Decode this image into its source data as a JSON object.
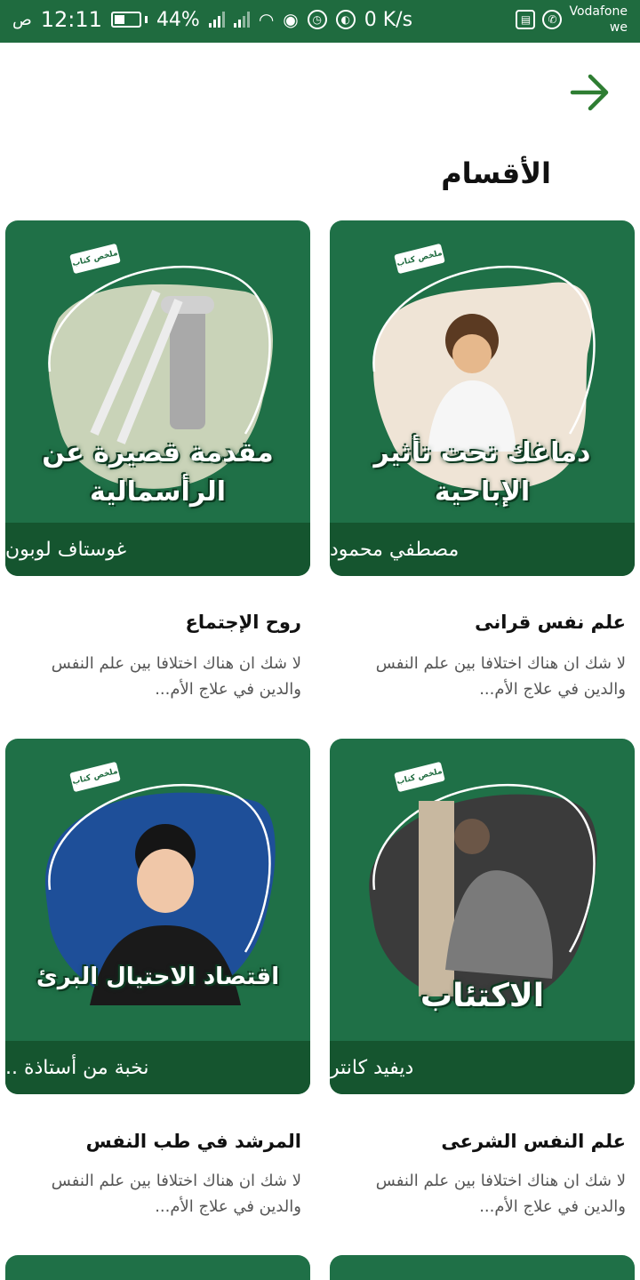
{
  "status_bar": {
    "time": "12:11",
    "ampm": "ص",
    "battery": "44%",
    "battery_level": 0.44,
    "network_speed": "0 K/s",
    "carrier_line1": "Vodafone",
    "carrier_line2": "we",
    "signal_tag": "3G"
  },
  "header": {
    "back_icon": "arrow-right-icon",
    "section_title": "الأقسام"
  },
  "colors": {
    "primary": "#1f6b3f",
    "card_bg": "#1f7047",
    "card_footer": "#15552f",
    "back_arrow": "#2e7d32"
  },
  "cards": [
    {
      "headline": "دماغك تحت تأثير الإباحية",
      "author": "مصطفي محمود",
      "title": "علم نفس قرانى",
      "description": "لا شك ان هناك اختلافا بين علم النفس والدين في علاج الأم...",
      "badge": "ملخص كتاب"
    },
    {
      "headline": "مقدمة قصيرة عن الرأسمالية",
      "author": "غوستاف لوبون",
      "title": "روح الإجتماع",
      "description": "لا شك ان هناك اختلافا بين علم النفس والدين في علاج الأم...",
      "badge": "ملخص كتاب"
    },
    {
      "headline": "الاكتئاب",
      "author": "ديفيد كانتر",
      "title": "علم النفس الشرعى",
      "description": "لا شك ان هناك اختلافا بين علم النفس والدين في علاج الأم...",
      "badge": "ملخص كتاب"
    },
    {
      "headline": "اقتصاد الاحتيال البرئ",
      "author": "نخبة من أستاذة ..",
      "title": "المرشد في طب النفس",
      "description": "لا شك ان هناك اختلافا بين علم النفس والدين في علاج الأم...",
      "badge": "ملخص كتاب"
    }
  ]
}
